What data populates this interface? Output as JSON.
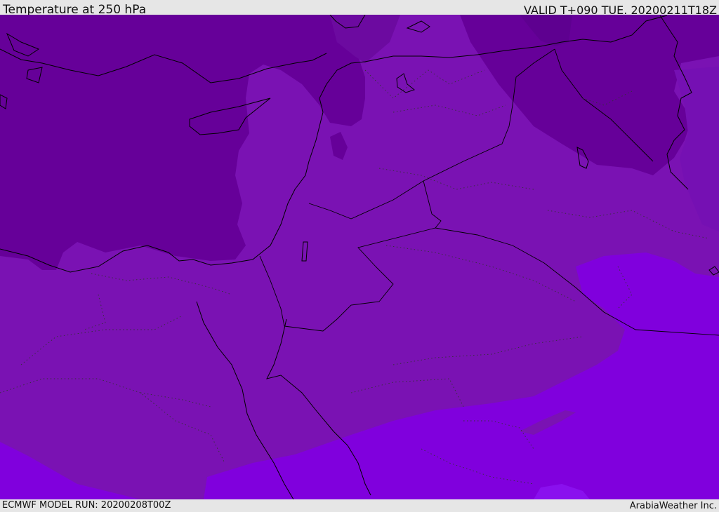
{
  "header": {
    "title": "Temperature at 250 hPa",
    "valid_time": "VALID T+090 TUE. 20200211T18Z"
  },
  "footer": {
    "model_run": "ECMWF MODEL RUN: 20200208T00Z",
    "credit": "ArabiaWeather Inc."
  },
  "map": {
    "field": "temperature",
    "level": "250 hPa",
    "region": "Eastern Mediterranean, Egypt, Levant, Arabian Peninsula",
    "palette": {
      "coldest": "#660099",
      "colder": "#6c0aa0",
      "cold": "#7510b3",
      "mid": "#7a12b3",
      "warm": "#8000dd",
      "warmest": "#8a10ee"
    },
    "linework": {
      "coastline_color": "#000000",
      "admin_border_color": "#333333"
    }
  }
}
